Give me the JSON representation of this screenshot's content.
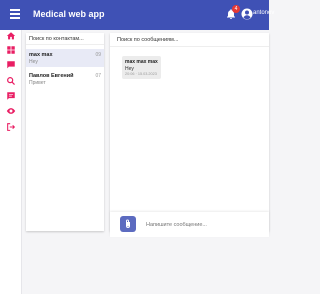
{
  "app": {
    "title": "Medical web app"
  },
  "header": {
    "notification_count": "4",
    "username": "antonov"
  },
  "sidebar": {
    "items": [
      {
        "icon": "home-icon"
      },
      {
        "icon": "dashboard-icon"
      },
      {
        "icon": "chat-icon"
      },
      {
        "icon": "search-icon"
      },
      {
        "icon": "message-icon"
      },
      {
        "icon": "eye-icon"
      },
      {
        "icon": "logout-icon"
      }
    ]
  },
  "contacts": {
    "search_placeholder": "Поиск по контактам...",
    "list": [
      {
        "name": "max max",
        "preview": "Hey",
        "date": "09",
        "active": true
      },
      {
        "name": "Павлов Евгений",
        "preview": "Привет",
        "date": "07",
        "active": false
      }
    ]
  },
  "chat": {
    "search_placeholder": "Поиск по сообщениям...",
    "messages": [
      {
        "author": "max max max",
        "text": "Hey",
        "time": "20:06 · 15.03.2023"
      }
    ],
    "composer_placeholder": "Напишите сообщение..."
  },
  "colors": {
    "primary": "#3f51b5",
    "accent": "#e91e63",
    "badge": "#e53935"
  }
}
